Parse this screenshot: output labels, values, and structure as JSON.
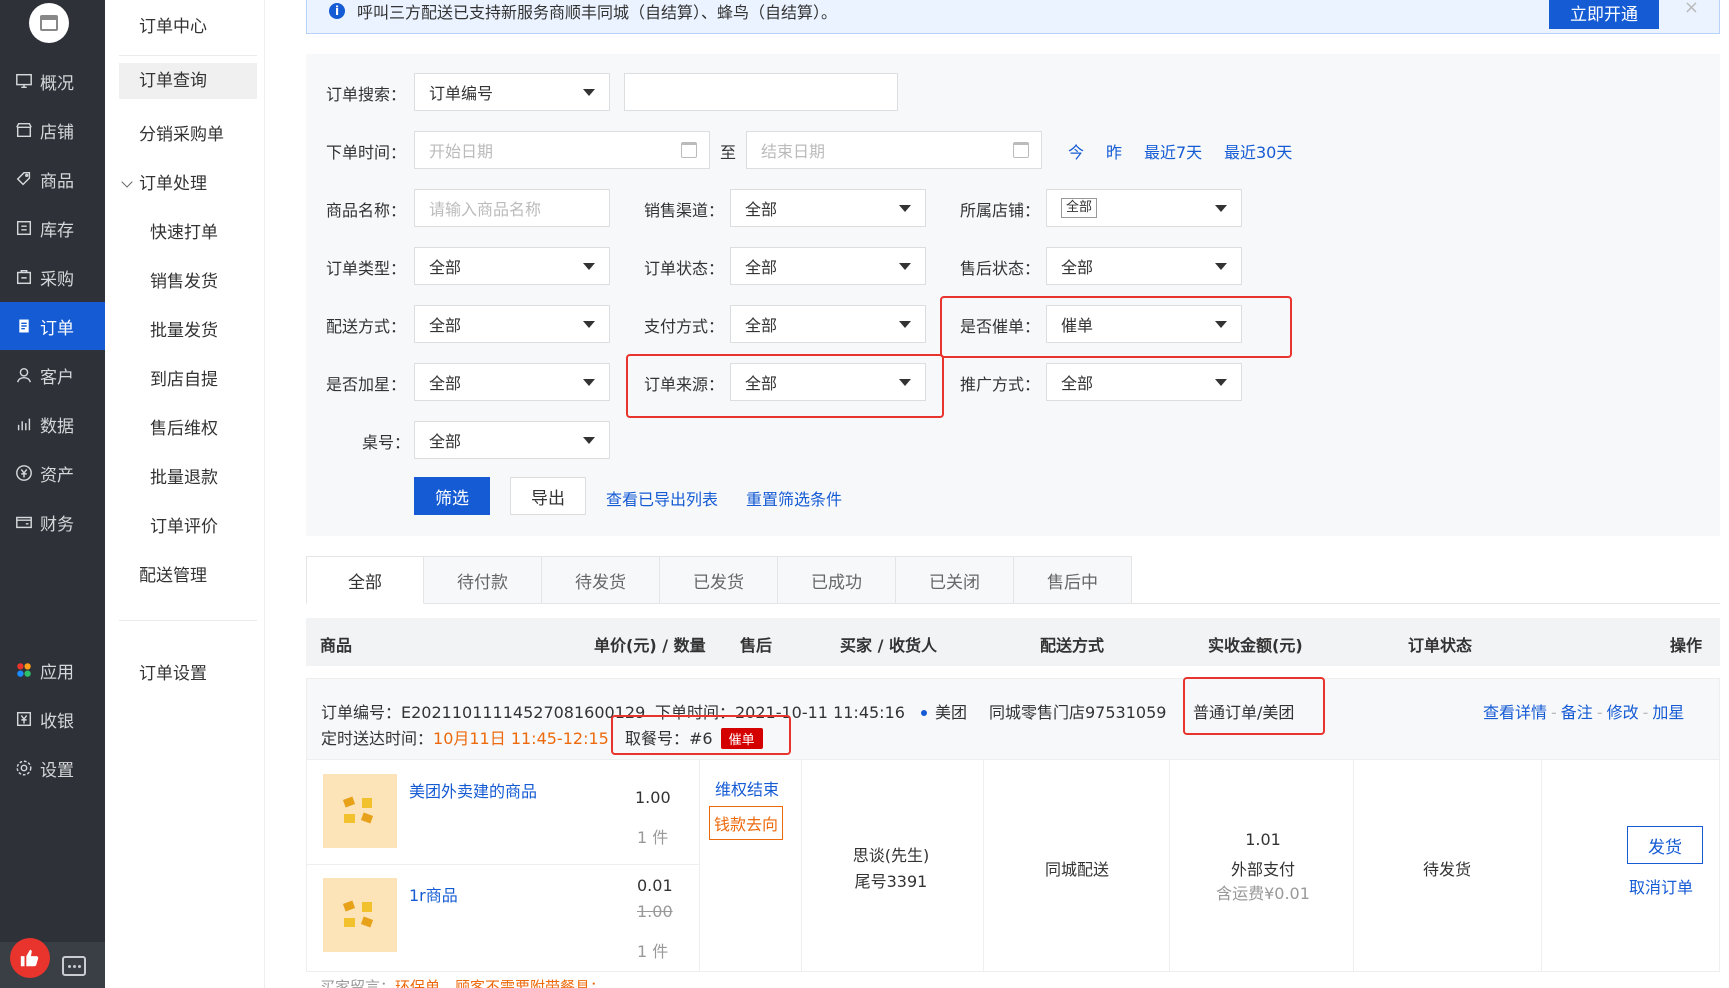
{
  "sidebar": {
    "items": [
      {
        "label": "概况",
        "icon": "monitor-icon"
      },
      {
        "label": "店铺",
        "icon": "shop-icon"
      },
      {
        "label": "商品",
        "icon": "tag-icon"
      },
      {
        "label": "库存",
        "icon": "warehouse-icon"
      },
      {
        "label": "采购",
        "icon": "purchase-icon"
      },
      {
        "label": "订单",
        "icon": "order-icon"
      },
      {
        "label": "客户",
        "icon": "user-icon"
      },
      {
        "label": "数据",
        "icon": "bar-chart-icon"
      },
      {
        "label": "资产",
        "icon": "yen-icon"
      },
      {
        "label": "财务",
        "icon": "wallet-icon"
      }
    ],
    "bottom_items": [
      {
        "label": "应用",
        "icon": "apps-icon"
      },
      {
        "label": "收银",
        "icon": "cashier-icon"
      },
      {
        "label": "设置",
        "icon": "gear-icon"
      }
    ]
  },
  "subnav": {
    "title": "订单中心",
    "items": [
      "订单查询",
      "分销采购单"
    ],
    "group": "订单处理",
    "children": [
      "快速打单",
      "销售发货",
      "批量发货",
      "到店自提",
      "售后维权",
      "批量退款",
      "订单评价"
    ],
    "extra": "配送管理",
    "settings": "订单设置"
  },
  "notice": {
    "text": "呼叫三方配送已支持新服务商顺丰同城（自结算）、蜂鸟（自结算）。",
    "button": "立即开通",
    "close": "×"
  },
  "filter": {
    "search_label": "订单搜索：",
    "search_type": "订单编号",
    "time_label": "下单时间：",
    "start_placeholder": "开始日期",
    "to": "至",
    "end_placeholder": "结束日期",
    "quick": [
      "今",
      "昨",
      "最近7天",
      "最近30天"
    ],
    "goods_label": "商品名称：",
    "goods_placeholder": "请输入商品名称",
    "channel_label": "销售渠道：",
    "channel_value": "全部",
    "store_label": "所属店铺：",
    "store_value": "全部",
    "type_label": "订单类型：",
    "type_value": "全部",
    "status_label": "订单状态：",
    "status_value": "全部",
    "after_label": "售后状态：",
    "after_value": "全部",
    "delivery_label": "配送方式：",
    "delivery_value": "全部",
    "pay_label": "支付方式：",
    "pay_value": "全部",
    "urge_label": "是否催单：",
    "urge_value": "催单",
    "star_label": "是否加星：",
    "star_value": "全部",
    "source_label": "订单来源：",
    "source_value": "全部",
    "promo_label": "推广方式：",
    "promo_value": "全部",
    "table_label": "桌号：",
    "table_value": "全部",
    "filter_btn": "筛选",
    "export_btn": "导出",
    "view_exported": "查看已导出列表",
    "reset": "重置筛选条件"
  },
  "tabs": [
    "全部",
    "待付款",
    "待发货",
    "已发货",
    "已成功",
    "已关闭",
    "售后中"
  ],
  "table_headers": [
    "商品",
    "单价(元) / 数量",
    "售后",
    "买家 / 收货人",
    "配送方式",
    "实收金额(元)",
    "订单状态",
    "操作"
  ],
  "order": {
    "number": "订单编号：E20211011114527081600129",
    "time": "下单时间：2021-10-11 11:45:16",
    "platform": "美团",
    "store": "同城零售门店97531059",
    "type": "普通订单/美团",
    "actions": [
      "查看详情",
      "备注",
      "修改",
      "加星"
    ],
    "deliver_label": "定时送达时间：",
    "deliver_time": "10月11日 11:45-12:15",
    "pickup": "取餐号：#6",
    "urge_tag": "催单",
    "goods": [
      {
        "name": "美团外卖建的商品",
        "price": "1.00",
        "qty": "1 件",
        "after_status": "维权结束",
        "after_btn": "钱款去向"
      },
      {
        "name": "1r商品",
        "price": "0.01",
        "orig_price": "1.00",
        "qty": "1 件"
      }
    ],
    "buyer": "思谈(先生)",
    "buyer_tail": "尾号3391",
    "delivery": "同城配送",
    "amount": "1.01",
    "pay_method": "外部支付",
    "freight": "含运费¥0.01",
    "status": "待发货",
    "ship_btn": "发货",
    "cancel": "取消订单",
    "message": "买家留言：",
    "message_text": "环保单，顾客不需要附带餐具；"
  }
}
